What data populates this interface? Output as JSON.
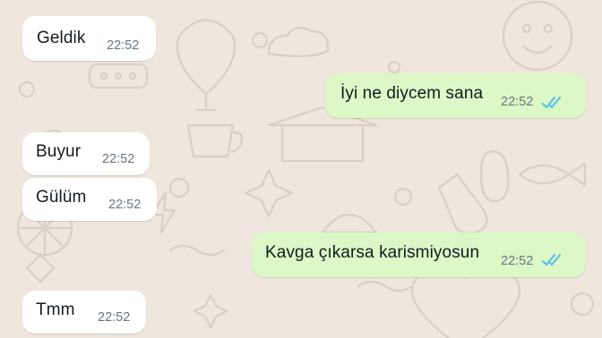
{
  "conversation": {
    "messages": [
      {
        "direction": "incoming",
        "text": "Geldik",
        "time": "22:52"
      },
      {
        "direction": "outgoing",
        "text": "İyi ne diycem sana",
        "time": "22:52",
        "read_status": "double-check-read"
      },
      {
        "direction": "incoming",
        "text": "Buyur",
        "time": "22:52"
      },
      {
        "direction": "incoming",
        "text": "Gülüm",
        "time": "22:52"
      },
      {
        "direction": "outgoing",
        "text": "Kavga çıkarsa karismiyosun",
        "time": "22:52",
        "read_status": "double-check-read"
      },
      {
        "direction": "incoming",
        "text": "Tmm",
        "time": "22:52"
      }
    ]
  },
  "colors": {
    "background": "#efe7dd",
    "incoming_bubble": "#ffffff",
    "outgoing_bubble": "#dcf8c6",
    "read_ticks": "#53bdeb",
    "timestamp": "#667781"
  }
}
